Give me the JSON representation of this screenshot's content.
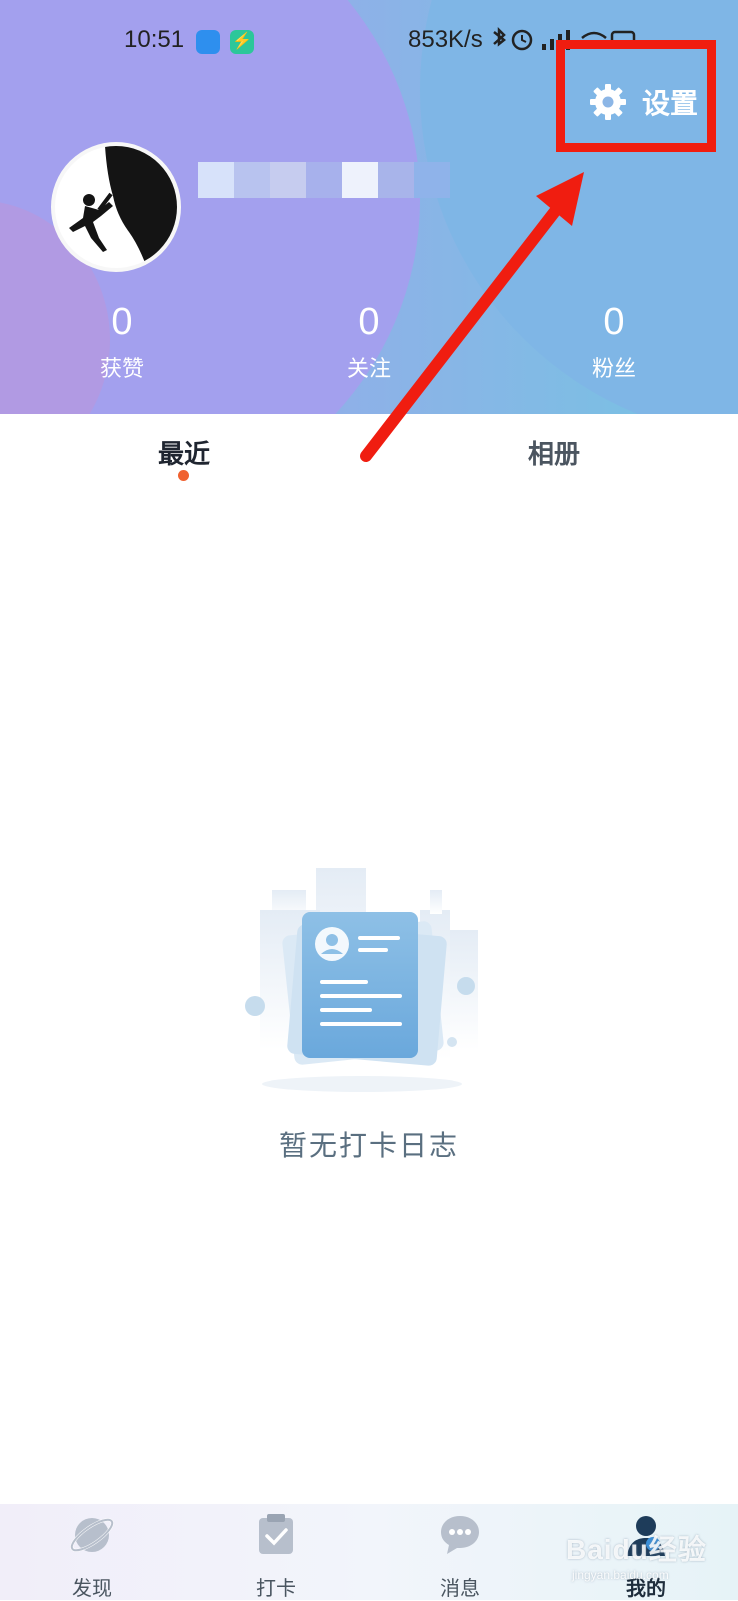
{
  "status_bar": {
    "time": "10:51",
    "network_speed": "853K/s",
    "lightning_glyph": "⚡"
  },
  "header": {
    "settings_label": "设置",
    "settings_icon": "gear-icon"
  },
  "profile": {
    "avatar_icon": "rock-climber-avatar"
  },
  "stats": [
    {
      "value": "0",
      "label": "获赞"
    },
    {
      "value": "0",
      "label": "关注"
    },
    {
      "value": "0",
      "label": "粉丝"
    }
  ],
  "tabs": [
    {
      "label": "最近",
      "active": true
    },
    {
      "label": "相册",
      "active": false
    }
  ],
  "empty_state": {
    "message": "暂无打卡日志",
    "icon": "empty-log-document-icon"
  },
  "bottom_nav": [
    {
      "label": "发现",
      "icon": "planet-icon",
      "active": false
    },
    {
      "label": "打卡",
      "icon": "clipboard-check-icon",
      "active": false
    },
    {
      "label": "消息",
      "icon": "chat-bubble-icon",
      "active": false
    },
    {
      "label": "我的",
      "icon": "user-icon",
      "active": true
    }
  ],
  "watermark": {
    "text": "Baidu经验",
    "sub": "jingyan.baidu.com"
  },
  "colors": {
    "annotation": "#f01d10",
    "active_dot": "#f06130",
    "header_left": "#9aa6ec",
    "header_right": "#75c4e2"
  }
}
